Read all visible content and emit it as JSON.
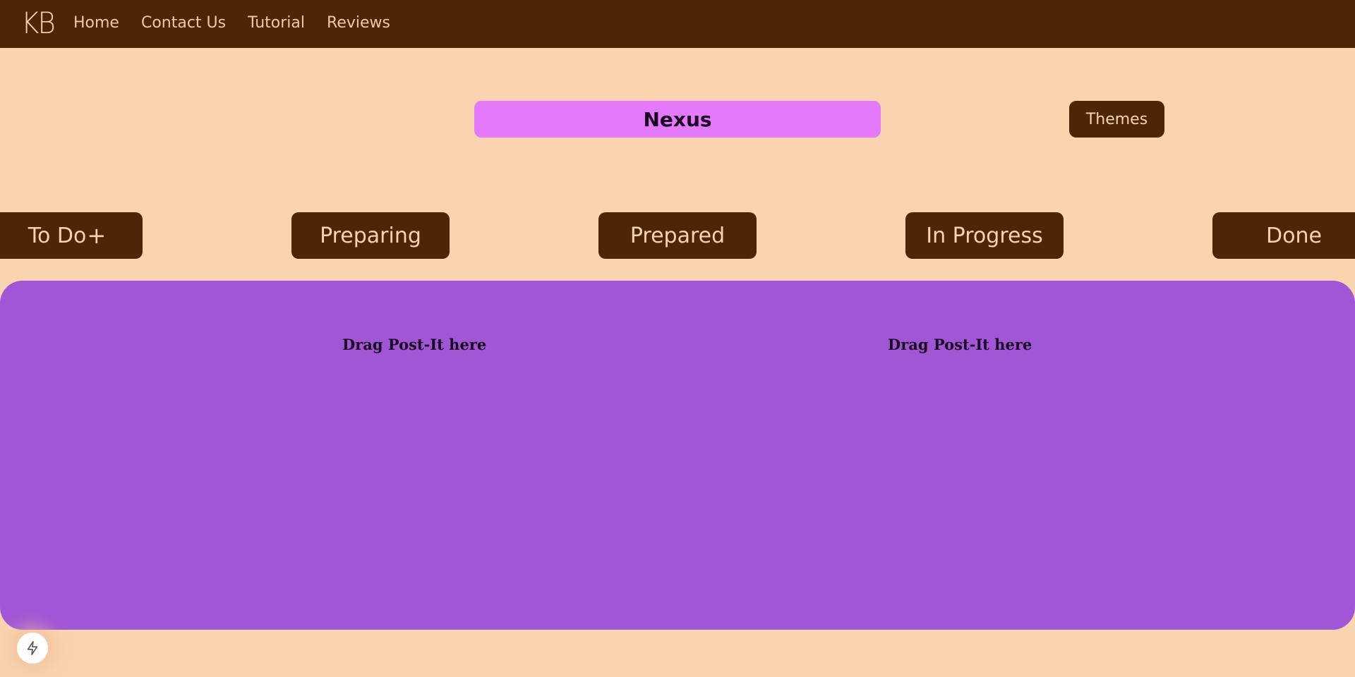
{
  "nav": {
    "brand": "KB",
    "links": [
      "Home",
      "Contact Us",
      "Tutorial",
      "Reviews"
    ]
  },
  "board": {
    "title": "Nexus",
    "themes_label": "Themes"
  },
  "columns": [
    {
      "label": "To Do",
      "add_icon": "+"
    },
    {
      "label": "Preparing"
    },
    {
      "label": "Prepared"
    },
    {
      "label": "In Progress"
    },
    {
      "label": "Done"
    }
  ],
  "drop_area": {
    "hints": [
      "Drag Post-It here",
      "Drag Post-It here"
    ]
  },
  "floating_button": {
    "icon": "lightning-bolt-icon"
  },
  "colors": {
    "background": "#fad3af",
    "navbar": "#4d2606",
    "title_pill": "#e47afb",
    "drop_area": "#a057d6"
  }
}
